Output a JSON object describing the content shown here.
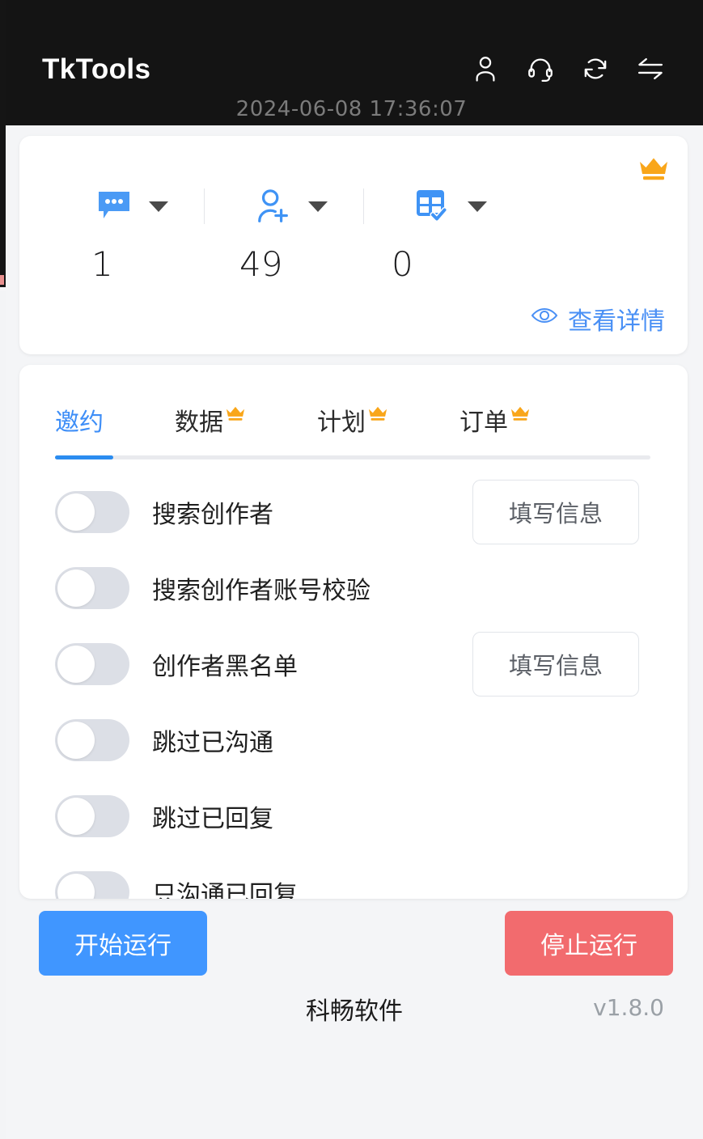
{
  "titlebar": {
    "app_title": "TkTools",
    "timestamp": "2024-06-08 17:36:07",
    "icons": [
      {
        "name": "user-icon",
        "label": "用户"
      },
      {
        "name": "headset-icon",
        "label": "客服"
      },
      {
        "name": "refresh-icon",
        "label": "刷新"
      },
      {
        "name": "switch-icon",
        "label": "切换"
      }
    ]
  },
  "stats": {
    "premium_badge": "crown-icon",
    "items": [
      {
        "icon": "message-bubble-icon",
        "value": "1"
      },
      {
        "icon": "add-user-icon",
        "value": "49"
      },
      {
        "icon": "table-check-icon",
        "value": "0"
      }
    ],
    "detail_link": "查看详情",
    "detail_icon": "eye-icon"
  },
  "tabs": [
    {
      "label": "邀约",
      "premium": false,
      "active": true
    },
    {
      "label": "数据",
      "premium": true,
      "active": false
    },
    {
      "label": "计划",
      "premium": true,
      "active": false
    },
    {
      "label": "订单",
      "premium": true,
      "active": false
    }
  ],
  "settings_rows": [
    {
      "label": "搜索创作者",
      "enabled": false,
      "action": "填写信息"
    },
    {
      "label": "搜索创作者账号校验",
      "enabled": false,
      "action": null
    },
    {
      "label": "创作者黑名单",
      "enabled": false,
      "action": "填写信息"
    },
    {
      "label": "跳过已沟通",
      "enabled": false,
      "action": null
    },
    {
      "label": "跳过已回复",
      "enabled": false,
      "action": null
    },
    {
      "label": "只沟通已回复",
      "enabled": false,
      "action": null
    },
    {
      "label": "",
      "enabled": false,
      "action": ""
    }
  ],
  "footer": {
    "start_label": "开始运行",
    "stop_label": "停止运行",
    "brand": "科畅软件",
    "version": "v1.8.0"
  },
  "colors": {
    "header_bg": "#141414",
    "accent_blue": "#4096ff",
    "stop_red": "#f26b6e",
    "crown_orange": "#f9a61a",
    "tab_active": "#3e8ef7",
    "toggle_off": "#dcdfe6",
    "page_bg": "#f4f5f7"
  }
}
